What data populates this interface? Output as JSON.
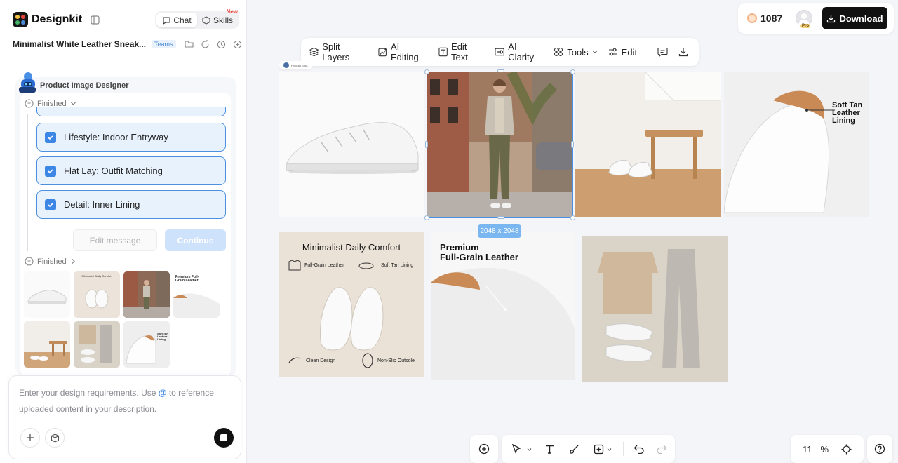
{
  "app": {
    "name": "Designkit",
    "logo_colors": [
      "#f6c244",
      "#e6433c",
      "#43b26b",
      "#4c8ad6"
    ]
  },
  "header": {
    "tabs": [
      {
        "label": "Chat",
        "active": true
      },
      {
        "label": "Skills",
        "active": false
      }
    ],
    "new_badge": "New",
    "project_title": "Minimalist White Leather Sneak...",
    "teams_badge": "Teams"
  },
  "assistant": {
    "name": "Product Image Designer"
  },
  "conversation": {
    "status_finished_1": "Finished",
    "status_finished_2": "Finished",
    "tasks": [
      {
        "label": "Lifestyle: Indoor Entryway",
        "checked": true
      },
      {
        "label": "Flat Lay: Outfit Matching",
        "checked": true
      },
      {
        "label": "Detail: Inner Lining",
        "checked": true
      }
    ],
    "edit_message_label": "Edit message",
    "continue_label": "Continue",
    "thumbnails": [
      {
        "name": "side-view",
        "text": ""
      },
      {
        "name": "infographic",
        "text": "Minimalist Daily Comfort"
      },
      {
        "name": "street-model",
        "text": ""
      },
      {
        "name": "premium-detail",
        "text": "Premium Full-Grain Leather"
      },
      {
        "name": "entryway",
        "text": ""
      },
      {
        "name": "flatlay",
        "text": ""
      },
      {
        "name": "lining",
        "text": "Soft Tan Leather Lining"
      }
    ]
  },
  "input": {
    "placeholder_before": "Enter your design requirements. Use",
    "at_symbol": "@",
    "placeholder_after": "to reference uploaded content in your description."
  },
  "topbar": {
    "credits": "1087",
    "pro_badge": "Pro",
    "download_label": "Download"
  },
  "toolbar": {
    "items": [
      {
        "label": "Split Layers",
        "icon": "layers-icon"
      },
      {
        "label": "AI Editing",
        "icon": "ai-edit-icon"
      },
      {
        "label": "Edit Text",
        "icon": "text-box-icon"
      },
      {
        "label": "AI Clarity",
        "icon": "hd-icon"
      },
      {
        "label": "Tools",
        "icon": "grid-icon"
      },
      {
        "label": "Edit",
        "icon": "sliders-icon"
      }
    ]
  },
  "canvas": {
    "selection_dimensions": "2048 x 2048",
    "infographic": {
      "title": "Minimalist Daily Comfort",
      "f1": "Full-Grain Leather",
      "f2": "Soft Tan Lining",
      "f3": "Clean Design",
      "f4": "Non-Slip Outsole"
    },
    "premium": {
      "line1": "Premium",
      "line2": "Full-Grain Leather"
    },
    "lining": {
      "line1": "Soft Tan",
      "line2": "Leather",
      "line3": "Lining"
    },
    "small_label": "Product Sho..."
  },
  "zoom": {
    "value": "11",
    "unit": "%"
  }
}
